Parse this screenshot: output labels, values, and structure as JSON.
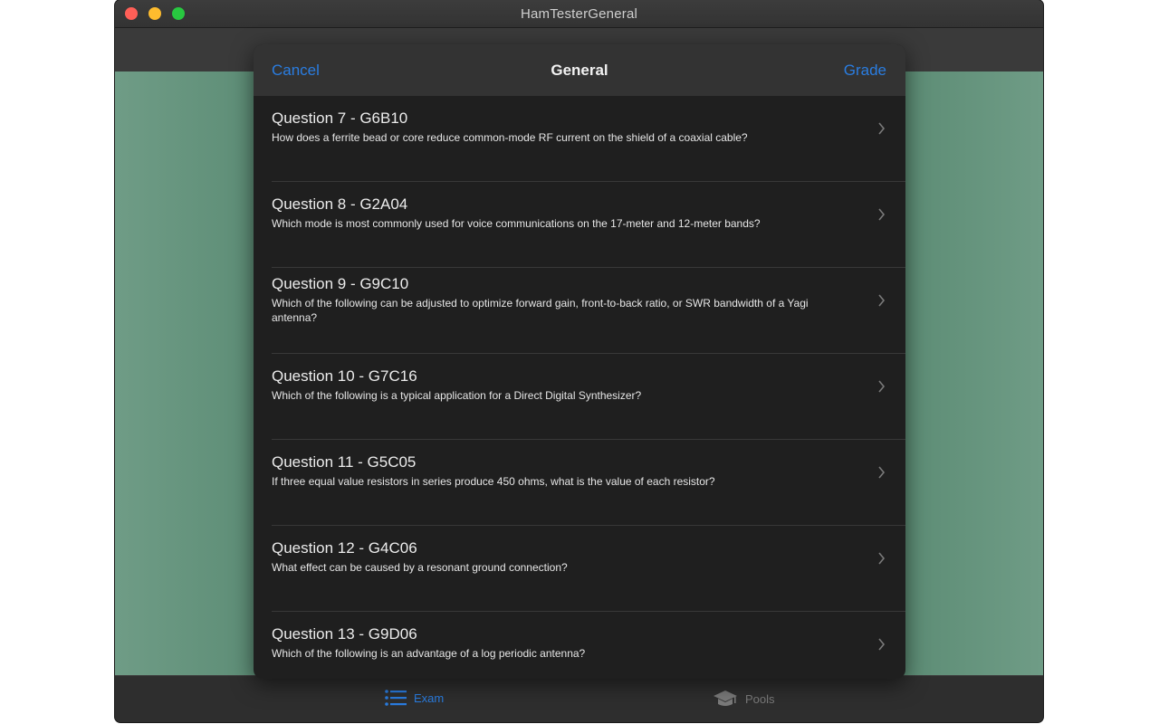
{
  "window": {
    "title": "HamTesterGeneral"
  },
  "sheet": {
    "cancel_label": "Cancel",
    "title": "General",
    "grade_label": "Grade"
  },
  "questions": [
    {
      "title": "Question 7 - G6B10",
      "text": "How does a ferrite bead or core reduce common-mode RF current on the shield of a coaxial cable?"
    },
    {
      "title": "Question 8 - G2A04",
      "text": "Which mode is most commonly used for voice communications on the 17-meter and 12-meter bands?"
    },
    {
      "title": "Question 9 - G9C10",
      "text": "Which of the following can be adjusted to optimize forward gain, front-to-back ratio, or SWR bandwidth of a Yagi antenna?"
    },
    {
      "title": "Question 10 - G7C16",
      "text": "Which of the following is a typical application for a Direct Digital Synthesizer?"
    },
    {
      "title": "Question 11 - G5C05",
      "text": "If three equal value resistors in series produce 450 ohms, what is the value of each resistor?"
    },
    {
      "title": "Question 12 - G4C06",
      "text": "What effect can be caused by a resonant ground connection?"
    },
    {
      "title": "Question 13 - G9D06",
      "text": "Which of the following is an advantage of a log periodic antenna?"
    }
  ],
  "tabbar": {
    "exam_label": "Exam",
    "pools_label": "Pools",
    "exam_icon": "list-icon",
    "pools_icon": "graduation-cap-icon"
  },
  "colors": {
    "accent": "#2a7de1"
  }
}
